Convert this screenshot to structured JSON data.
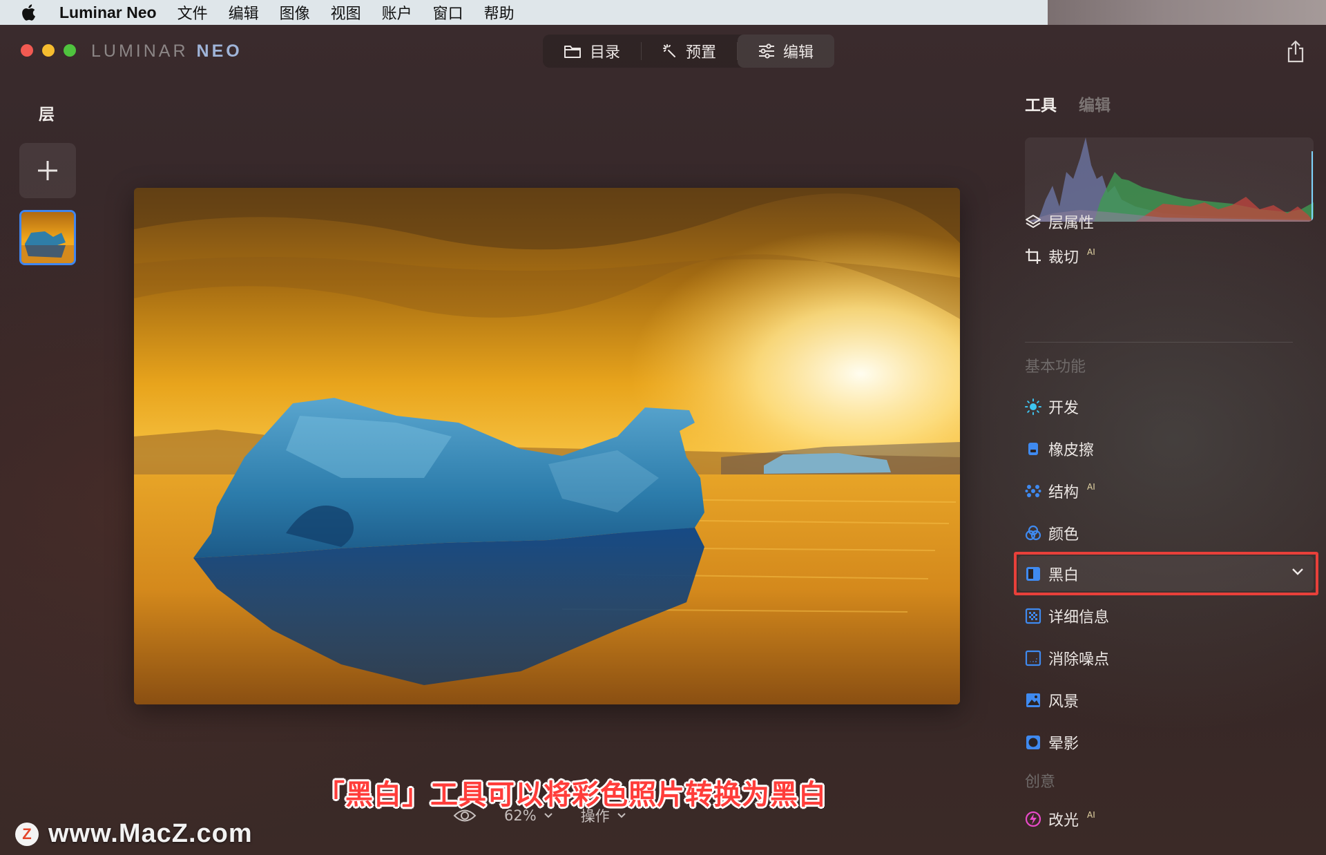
{
  "menubar": {
    "app_name": "Luminar Neo",
    "items": [
      "文件",
      "编辑",
      "图像",
      "视图",
      "账户",
      "窗口",
      "帮助"
    ]
  },
  "brand": {
    "part1": "LUMINAR",
    "part2": "NEO"
  },
  "topnav": {
    "tabs": [
      {
        "label": "目录",
        "icon": "folder-icon"
      },
      {
        "label": "预置",
        "icon": "magic-wand-icon"
      },
      {
        "label": "编辑",
        "icon": "sliders-icon",
        "active": true
      }
    ]
  },
  "layers": {
    "title": "层"
  },
  "right_panel": {
    "tab_tools": "工具",
    "tab_edit": "编辑",
    "items_top": [
      {
        "label": "层属性",
        "icon": "layers-icon"
      },
      {
        "label": "裁切",
        "icon": "crop-icon",
        "ai": "AI"
      }
    ],
    "section_basic": "基本功能",
    "items_basic": [
      {
        "label": "开发",
        "icon": "sun-icon"
      },
      {
        "label": "橡皮擦",
        "icon": "eraser-icon"
      },
      {
        "label": "结构",
        "icon": "structure-icon",
        "ai": "AI"
      },
      {
        "label": "颜色",
        "icon": "color-icon"
      },
      {
        "label": "黑白",
        "icon": "black-white-icon"
      },
      {
        "label": "详细信息",
        "icon": "details-icon"
      },
      {
        "label": "消除噪点",
        "icon": "denoise-icon"
      },
      {
        "label": "风景",
        "icon": "landscape-icon"
      },
      {
        "label": "晕影",
        "icon": "vignette-icon"
      }
    ],
    "section_creative": "创意",
    "items_creative": [
      {
        "label": "改光",
        "icon": "relight-icon",
        "ai": "AI"
      }
    ]
  },
  "bottom": {
    "zoom": "62%",
    "actions": "操作"
  },
  "caption": "「黑白」工具可以将彩色照片转换为黑白",
  "watermark": {
    "text": "www.MacZ.com",
    "logo": "Z"
  },
  "colors": {
    "accent_blue": "#3f86f0",
    "highlight_red": "#e8403a",
    "caption_red": "#ff3d3a"
  }
}
